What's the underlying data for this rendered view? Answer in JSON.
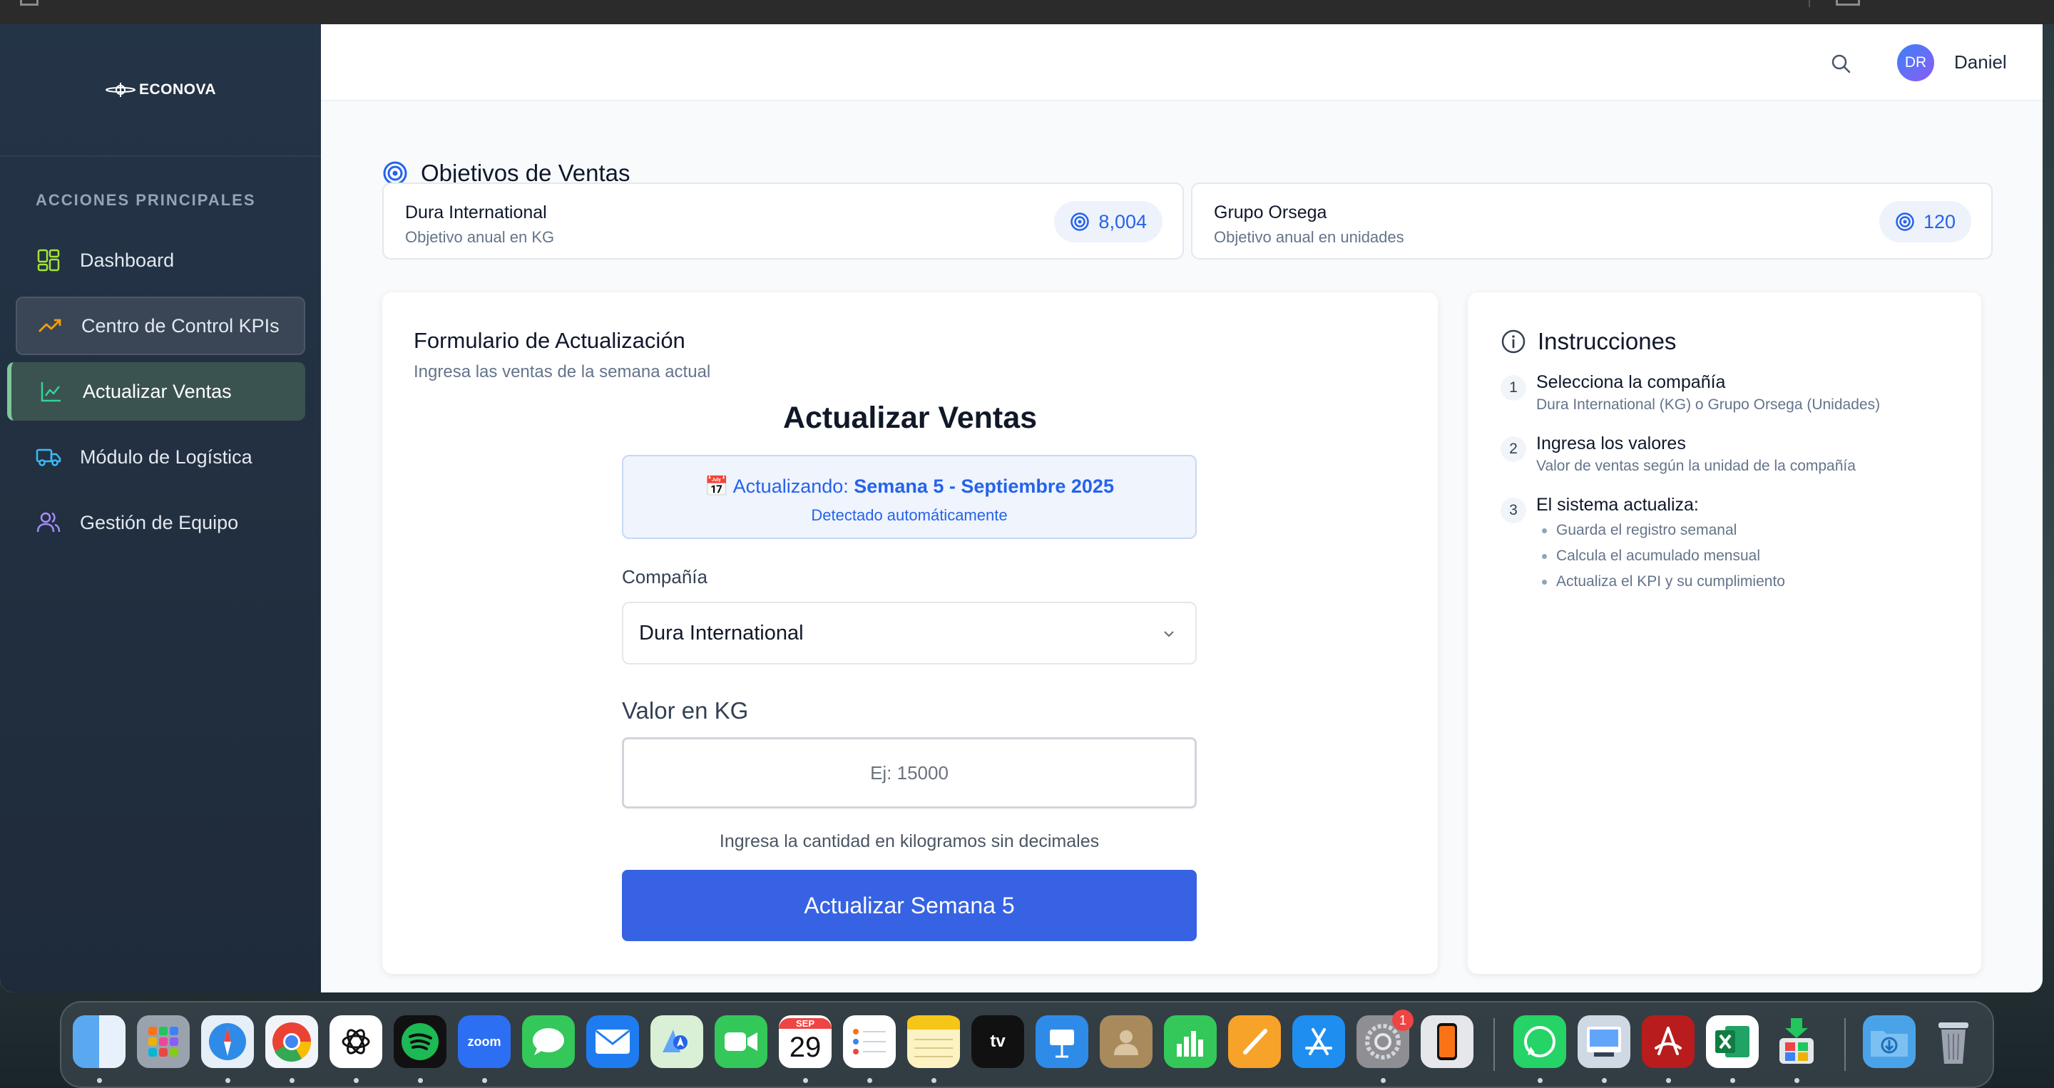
{
  "app": {
    "brand": "ECONOVA",
    "user_initials": "DR",
    "user_name": "Daniel"
  },
  "sidebar": {
    "section_title": "ACCIONES PRINCIPALES",
    "items": [
      {
        "label": "Dashboard",
        "icon": "grid-icon",
        "color": "#a3e635"
      },
      {
        "label": "Centro de Control KPIs",
        "icon": "trending-up-icon",
        "color": "#f59e0b"
      },
      {
        "label": "Actualizar Ventas",
        "icon": "line-chart-icon",
        "color": "#34d399",
        "active": true
      },
      {
        "label": "Módulo de Logística",
        "icon": "truck-icon",
        "color": "#38bdf8"
      },
      {
        "label": "Gestión de Equipo",
        "icon": "users-icon",
        "color": "#a78bfa"
      }
    ]
  },
  "page": {
    "title": "Objetivos de Ventas",
    "targets": [
      {
        "company": "Dura International",
        "subtitle": "Objetivo anual en KG",
        "value": "8,004"
      },
      {
        "company": "Grupo Orsega",
        "subtitle": "Objetivo anual en unidades",
        "value": "120"
      }
    ]
  },
  "form": {
    "card_title": "Formulario de Actualización",
    "card_subtitle": "Ingresa las ventas de la semana actual",
    "heading": "Actualizar Ventas",
    "week_prefix": "📅 Actualizando: ",
    "week_value": "Semana 5 - Septiembre 2025",
    "week_note": "Detectado automáticamente",
    "company_label": "Compañía",
    "company_value": "Dura International",
    "value_label": "Valor en KG",
    "value_placeholder": "Ej: 15000",
    "value_hint": "Ingresa la cantidad en kilogramos sin decimales",
    "submit_label": "Actualizar Semana 5"
  },
  "instructions": {
    "title": "Instrucciones",
    "steps": [
      {
        "num": "1",
        "title": "Selecciona la compañía",
        "desc": "Dura International (KG) o Grupo Orsega (Unidades)"
      },
      {
        "num": "2",
        "title": "Ingresa los valores",
        "desc": "Valor de ventas según la unidad de la compañía"
      },
      {
        "num": "3",
        "title": "El sistema actualiza:",
        "bullets": [
          "Guarda el registro semanal",
          "Calcula el acumulado mensual",
          "Actualiza el KPI y su cumplimiento"
        ]
      }
    ]
  },
  "dock": {
    "zoom_label": "zoom",
    "calendar_month": "SEP",
    "calendar_day": "29",
    "tv_label": "tv",
    "settings_badge": "1",
    "apps": [
      "Finder",
      "Launchpad",
      "Safari",
      "Chrome",
      "ChatGPT",
      "Spotify",
      "Zoom",
      "Messages",
      "Mail",
      "Maps",
      "FaceTime",
      "Calendar",
      "Reminders",
      "Notes",
      "Apple TV",
      "Keynote",
      "Contacts",
      "Numbers",
      "Pages",
      "App Store",
      "System Settings",
      "iPhone Mirroring",
      "WhatsApp",
      "Preview",
      "Acrobat",
      "Excel",
      "Installer",
      "Downloads",
      "Trash"
    ]
  }
}
